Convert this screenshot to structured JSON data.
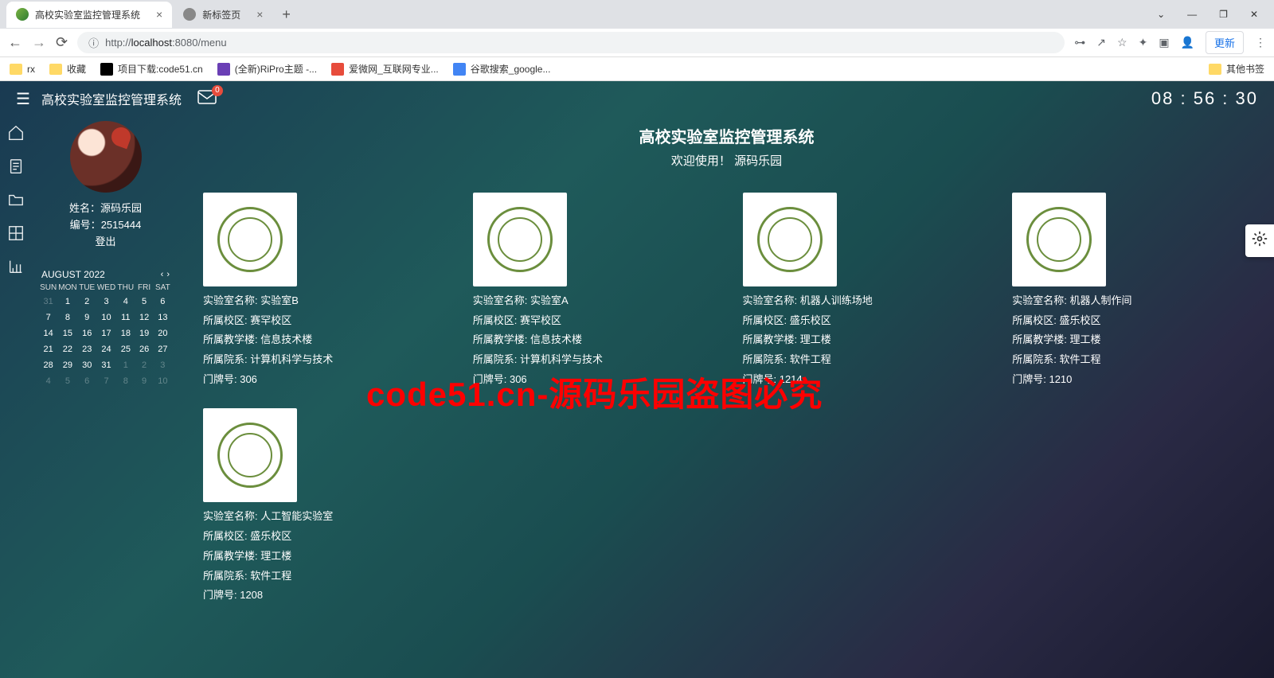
{
  "browser": {
    "tabs": [
      {
        "title": "高校实验室监控管理系统",
        "active": true
      },
      {
        "title": "新标签页",
        "active": false
      }
    ],
    "url_prefix": "ⓘ",
    "url_proto": "http://",
    "url_host": "localhost",
    "url_port_path": ":8080/menu",
    "update_btn": "更新",
    "window_controls": [
      "—",
      "❐",
      "✕"
    ],
    "bookmarks": [
      {
        "label": "rx",
        "icon_bg": "#ffd966",
        "type": "f"
      },
      {
        "label": "收藏",
        "icon_bg": "#ffd966",
        "type": "f"
      },
      {
        "label": "项目下载:code51.cn",
        "icon_bg": "#000",
        "type": "i"
      },
      {
        "label": "(全新)RiPro主题 -...",
        "icon_bg": "#6a3fb5",
        "type": "i"
      },
      {
        "label": "爱微网_互联网专业...",
        "icon_bg": "#e74c3c",
        "type": "i"
      },
      {
        "label": "谷歌搜索_google...",
        "icon_bg": "#4285f4",
        "type": "i"
      }
    ],
    "other_bookmarks": "其他书签"
  },
  "app": {
    "title": "高校实验室监控管理系统",
    "mail_badge": "0",
    "clock": "08 : 56 : 30"
  },
  "user": {
    "name_label": "姓名：",
    "name": "源码乐园",
    "id_label": "编号：",
    "id": "2515444",
    "logout": "登出"
  },
  "calendar": {
    "title": "AUGUST 2022",
    "dow": [
      "SUN",
      "MON",
      "TUE",
      "WED",
      "THU",
      "FRI",
      "SAT"
    ],
    "weeks": [
      [
        {
          "d": "31",
          "dim": true
        },
        {
          "d": "1"
        },
        {
          "d": "2"
        },
        {
          "d": "3"
        },
        {
          "d": "4"
        },
        {
          "d": "5"
        },
        {
          "d": "6"
        }
      ],
      [
        {
          "d": "7"
        },
        {
          "d": "8"
        },
        {
          "d": "9"
        },
        {
          "d": "10"
        },
        {
          "d": "11"
        },
        {
          "d": "12"
        },
        {
          "d": "13"
        }
      ],
      [
        {
          "d": "14"
        },
        {
          "d": "15"
        },
        {
          "d": "16"
        },
        {
          "d": "17"
        },
        {
          "d": "18"
        },
        {
          "d": "19"
        },
        {
          "d": "20"
        }
      ],
      [
        {
          "d": "21"
        },
        {
          "d": "22"
        },
        {
          "d": "23"
        },
        {
          "d": "24"
        },
        {
          "d": "25"
        },
        {
          "d": "26"
        },
        {
          "d": "27"
        }
      ],
      [
        {
          "d": "28"
        },
        {
          "d": "29"
        },
        {
          "d": "30"
        },
        {
          "d": "31"
        },
        {
          "d": "1",
          "dim": true
        },
        {
          "d": "2",
          "dim": true
        },
        {
          "d": "3",
          "dim": true
        }
      ],
      [
        {
          "d": "4",
          "dim": true
        },
        {
          "d": "5",
          "dim": true
        },
        {
          "d": "6",
          "dim": true
        },
        {
          "d": "7",
          "dim": true
        },
        {
          "d": "8",
          "dim": true
        },
        {
          "d": "9",
          "dim": true
        },
        {
          "d": "10",
          "dim": true
        }
      ]
    ]
  },
  "main": {
    "title": "高校实验室监控管理系统",
    "welcome": "欢迎使用！ 源码乐园"
  },
  "labels": {
    "name": "实验室名称:",
    "campus": "所属校区:",
    "building": "所属教学楼:",
    "dept": "所属院系:",
    "room": "门牌号:"
  },
  "cards": [
    {
      "name": "实验室B",
      "campus": "赛罕校区",
      "building": "信息技术楼",
      "dept": "计算机科学与技术",
      "room": "306"
    },
    {
      "name": "实验室A",
      "campus": "赛罕校区",
      "building": "信息技术楼",
      "dept": "计算机科学与技术",
      "room": "306"
    },
    {
      "name": "机器人训练场地",
      "campus": "盛乐校区",
      "building": "理工楼",
      "dept": "软件工程",
      "room": "1214"
    },
    {
      "name": "机器人制作间",
      "campus": "盛乐校区",
      "building": "理工楼",
      "dept": "软件工程",
      "room": "1210"
    },
    {
      "name": "人工智能实验室",
      "campus": "盛乐校区",
      "building": "理工楼",
      "dept": "软件工程",
      "room": "1208"
    }
  ],
  "watermark": "code51.cn-源码乐园盗图必究"
}
